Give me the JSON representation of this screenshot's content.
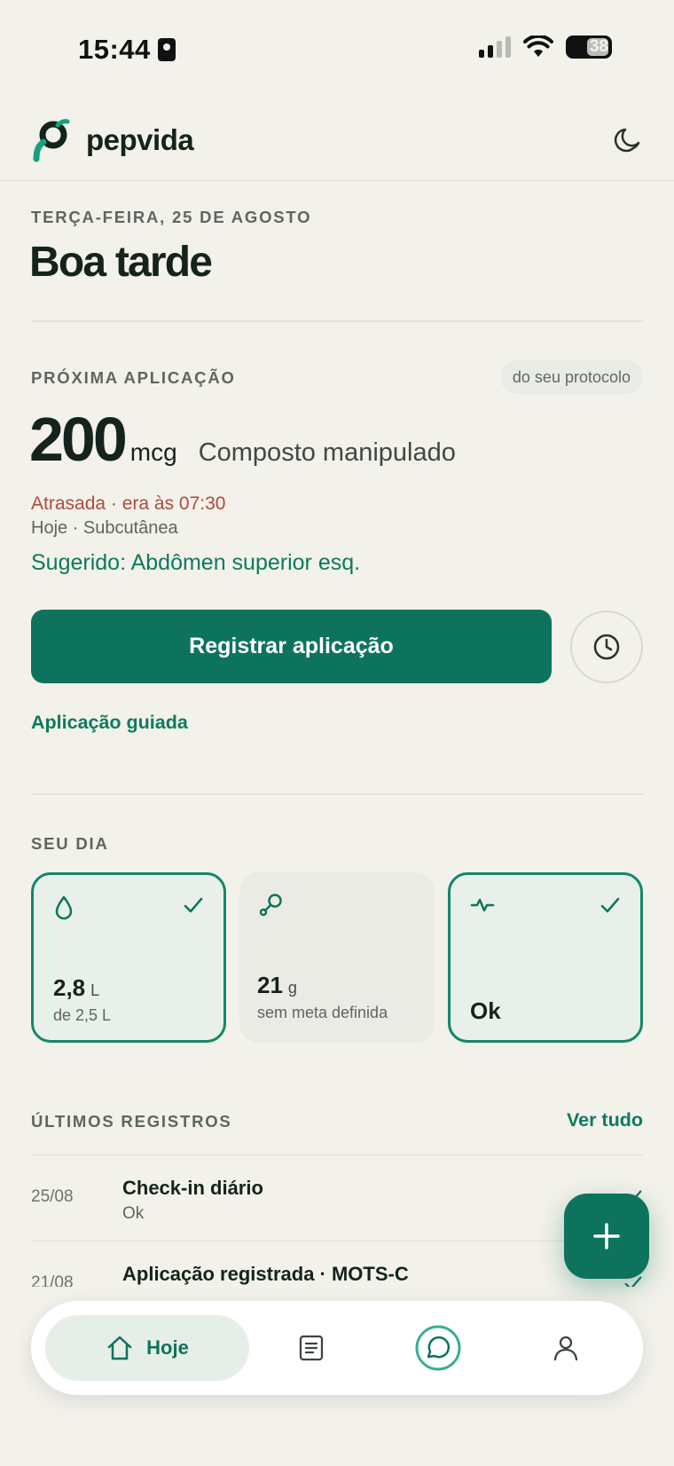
{
  "status_bar": {
    "time": "15:44",
    "battery": "38"
  },
  "app": {
    "name": "pepvida"
  },
  "header": {
    "date": "TERÇA-FEIRA, 25 DE AGOSTO",
    "greeting": "Boa tarde"
  },
  "next_dose": {
    "section_label": "PRÓXIMA APLICAÇÃO",
    "chip": "do seu protocolo",
    "amount": "200",
    "unit": "mcg",
    "compound": "Composto manipulado",
    "late_text": "Atrasada · era às 07:30",
    "when": "Hoje · Subcutânea",
    "suggestion": "Sugerido: Abdômen superior esq.",
    "primary_button": "Registrar aplicação",
    "guided_link": "Aplicação guiada"
  },
  "day": {
    "section_label": "SEU DIA",
    "cards": [
      {
        "icon": "water-drop-icon",
        "value": "2,8",
        "unit": "L",
        "sub": "de 2,5 L",
        "checked": true
      },
      {
        "icon": "protein-icon",
        "value": "21",
        "unit": "g",
        "sub": "sem meta definida",
        "checked": false
      },
      {
        "icon": "pulse-icon",
        "label": "Ok",
        "checked": true
      }
    ]
  },
  "records": {
    "section_label": "ÚLTIMOS REGISTROS",
    "see_all": "Ver tudo",
    "items": [
      {
        "date": "25/08",
        "title": "Check-in diário",
        "sub": "Ok"
      },
      {
        "date": "21/08",
        "title": "Aplicação registrada · MOTS-C",
        "sub": ""
      }
    ]
  },
  "nav": {
    "home_label": "Hoje"
  },
  "colors": {
    "primary": "#0d735c",
    "accent_text": "#0d7a5f",
    "late": "#b04a3e",
    "background": "#f2f1ea"
  }
}
